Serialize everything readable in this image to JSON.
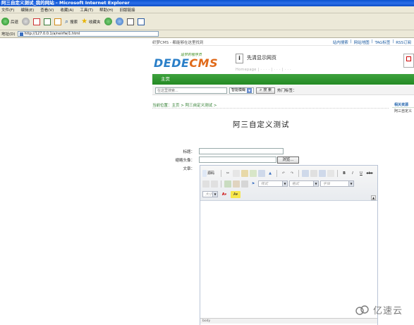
{
  "window": {
    "title": "阿三自定义测试_我的网站 - Microsoft Internet Explorer"
  },
  "menu": [
    "文件(F)",
    "编辑(E)",
    "查看(V)",
    "收藏(A)",
    "工具(T)",
    "帮助(H)",
    "旧版链接"
  ],
  "toolbar": {
    "back": "后退",
    "search": "搜索",
    "favorites": "收藏夹"
  },
  "address": {
    "label": "地址(D)",
    "url": "http://127.0.0.1/a/neirfw/1.html"
  },
  "page": {
    "topline_left": "织梦CMS - 都能够在这里找到",
    "topline_links": [
      "站内搜索",
      "网站地图",
      "TAG标签",
      "RSS订阅"
    ],
    "logo": {
      "slogan": "追梦的程序员",
      "brand_a": "DEDE",
      "brand_b": "CMS"
    },
    "site_title": "先清显示网页",
    "fade_text": "Homepage  |  ·  ·  ·  ·  |  ·  ·  ·  |  ·  ·  ·",
    "nav_home": "主页",
    "search": {
      "placeholder": "在这里搜索...",
      "select_value": "智能模糊",
      "button": "搜 索",
      "hot_label": "热门标签："
    },
    "breadcrumb": "当前位置：主页 > 阿三自定义测试 >",
    "sidebox": {
      "title": "相关资源",
      "item": "阿三自定义"
    },
    "heading": "阿三自定义测试",
    "form": {
      "title_label": "标题：",
      "thumb_label": "缩略头像：",
      "browse_button": "浏览...",
      "content_label": "文章："
    },
    "editor": {
      "source_label": "源码",
      "format_placeholder": "样式",
      "font_placeholder": "格式",
      "fontname_placeholder": "字体",
      "size_placeholder": "大小",
      "status": "body"
    },
    "watermark": "亿速云"
  }
}
